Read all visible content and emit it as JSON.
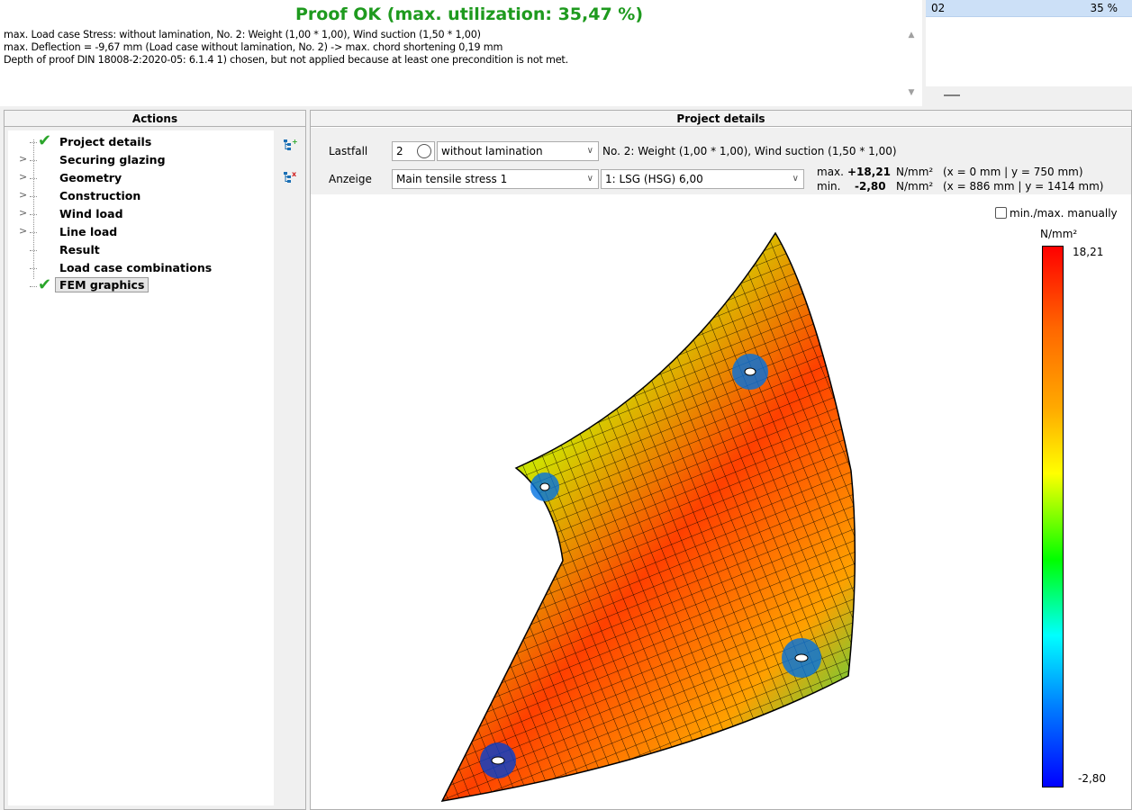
{
  "summary": {
    "title": "Proof OK (max. utilization: 35,47 %)",
    "line1": "max. Load case Stress: without lamination, No. 2:  Weight (1,00 * 1,00), Wind suction (1,50 * 1,00)",
    "line2": "max. Deflection = -9,67 mm (Load case without lamination, No. 2) -> max. chord shortening 0,19 mm",
    "line3": "Depth of proof DIN 18008-2:2020-05: 6.1.4 1) chosen, but not applied because at least one precondition is not met."
  },
  "side_list": {
    "id": "02",
    "utilization": "35 %"
  },
  "actions": {
    "header": "Actions",
    "items": [
      {
        "label": "Project details",
        "checked": true
      },
      {
        "label": "Securing glazing",
        "expandable": true
      },
      {
        "label": "Geometry",
        "expandable": true
      },
      {
        "label": "Construction",
        "expandable": true
      },
      {
        "label": "Wind load",
        "expandable": true
      },
      {
        "label": "Line load",
        "expandable": true
      },
      {
        "label": "Result"
      },
      {
        "label": "Load case combinations"
      },
      {
        "label": "FEM graphics",
        "checked": true,
        "selected": true
      }
    ]
  },
  "details": {
    "header": "Project details",
    "lastfall_label": "Lastfall",
    "lastfall_value": "2",
    "lastfall_variant": "without lamination",
    "lastfall_desc": "No. 2:  Weight (1,00 * 1,00), Wind suction (1,50 * 1,00)",
    "anzeige_label": "Anzeige",
    "anzeige_value": "Main tensile stress 1",
    "layer_value": "1: LSG (HSG) 6,00",
    "max_label": "max.",
    "max_value": "+18,21",
    "max_unit": "N/mm²",
    "max_loc": "(x = 0 mm | y = 750 mm)",
    "min_label": "min.",
    "min_value": "-2,80",
    "min_unit": "N/mm²",
    "min_loc": "(x = 886 mm | y = 1414 mm)",
    "manual_label": "min./max. manually",
    "legend_unit": "N/mm²",
    "legend_max": "18,21",
    "legend_min": "-2,80"
  },
  "colors": {
    "title_green": "#1e9a1e",
    "check_green": "#2aa52a",
    "selection_blue": "#cce0f7"
  }
}
